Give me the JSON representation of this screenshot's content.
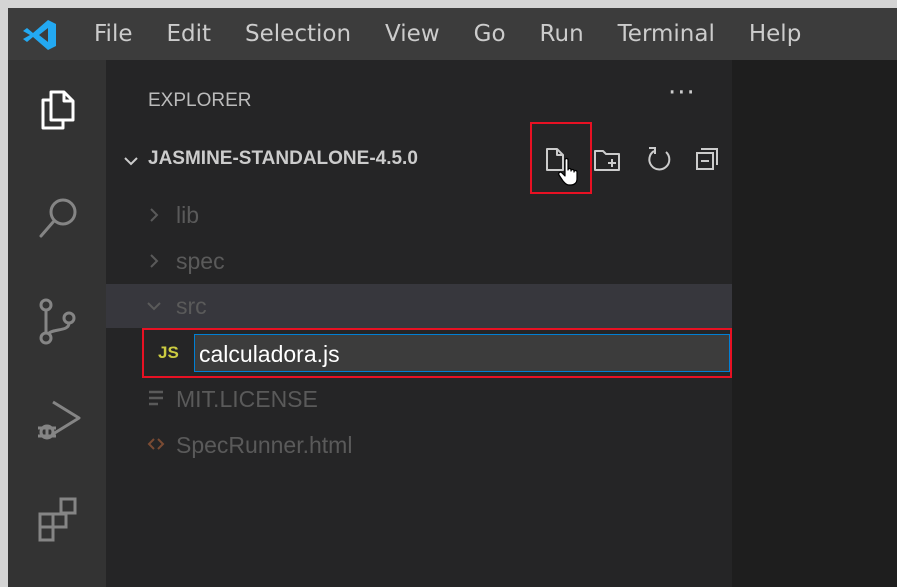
{
  "menu": [
    "File",
    "Edit",
    "Selection",
    "View",
    "Go",
    "Run",
    "Terminal",
    "Help"
  ],
  "activity_bar": [
    "explorer-icon",
    "search-icon",
    "source-control-icon",
    "run-debug-icon",
    "extensions-icon"
  ],
  "explorer": {
    "title": "EXPLORER",
    "more": "···",
    "section_title": "JASMINE-STANDALONE-4.5.0",
    "header_actions": [
      "new-file-icon",
      "new-folder-icon",
      "refresh-icon",
      "collapse-all-icon"
    ],
    "tree": [
      {
        "label": "lib",
        "kind": "folder",
        "expanded": false
      },
      {
        "label": "spec",
        "kind": "folder",
        "expanded": false
      },
      {
        "label": "src",
        "kind": "folder",
        "expanded": true
      },
      {
        "label": "MIT.LICENSE",
        "kind": "file"
      },
      {
        "label": "SpecRunner.html",
        "kind": "file"
      }
    ],
    "new_file": {
      "badge": "JS",
      "value": "calculadora.js"
    }
  },
  "colors": {
    "accent": "#007fd4",
    "highlight": "#e81123",
    "js_badge": "#cbcb41",
    "html_icon": "#e37933",
    "vscode_blue": "#23a9f2"
  }
}
